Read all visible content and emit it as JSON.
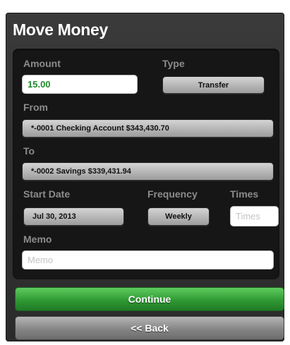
{
  "title": "Move Money",
  "form": {
    "amount_label": "Amount",
    "amount_value": "15.00",
    "type_label": "Type",
    "type_value": "Transfer",
    "from_label": "From",
    "from_value": "*-0001 Checking Account $343,430.70",
    "to_label": "To",
    "to_value": "*-0002 Savings $339,431.94",
    "start_date_label": "Start Date",
    "start_date_value": "Jul 30, 2013",
    "frequency_label": "Frequency",
    "frequency_value": "Weekly",
    "times_label": "Times",
    "times_placeholder": "Times",
    "memo_label": "Memo",
    "memo_placeholder": "Memo"
  },
  "buttons": {
    "continue_label": "Continue",
    "back_label": "<< Back"
  },
  "colors": {
    "continue": "#2f9a33",
    "amount_text": "#1f8c2a"
  }
}
